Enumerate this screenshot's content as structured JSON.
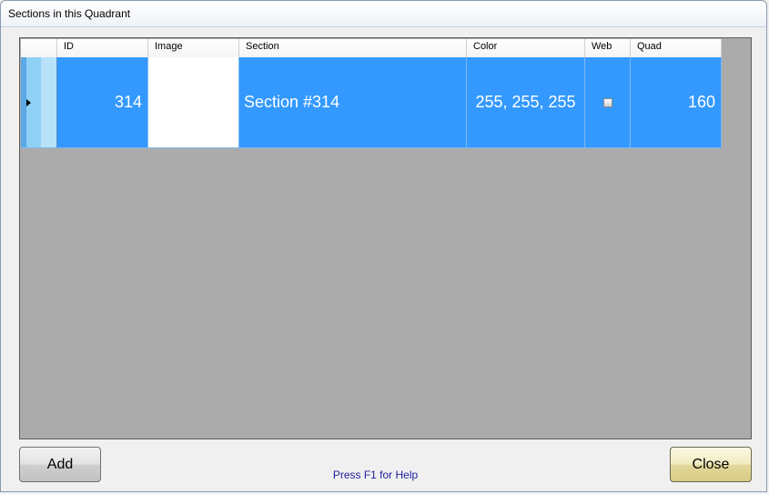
{
  "window": {
    "title": "Sections in this Quadrant"
  },
  "grid": {
    "columns": [
      {
        "key": "id",
        "label": "ID"
      },
      {
        "key": "image",
        "label": "Image"
      },
      {
        "key": "section",
        "label": "Section"
      },
      {
        "key": "color",
        "label": "Color"
      },
      {
        "key": "web",
        "label": "Web"
      },
      {
        "key": "quad",
        "label": "Quad"
      }
    ],
    "rows": [
      {
        "id": "314",
        "image": "",
        "section": "Section #314",
        "color": "255, 255, 255",
        "web": false,
        "quad": "160",
        "selected": true
      }
    ]
  },
  "buttons": {
    "add": "Add",
    "close": "Close"
  },
  "footer": {
    "help": "Press F1 for Help"
  },
  "colors": {
    "selection": "#3399ff",
    "grid_background": "#ababab",
    "help_text": "#1f1fa0"
  }
}
